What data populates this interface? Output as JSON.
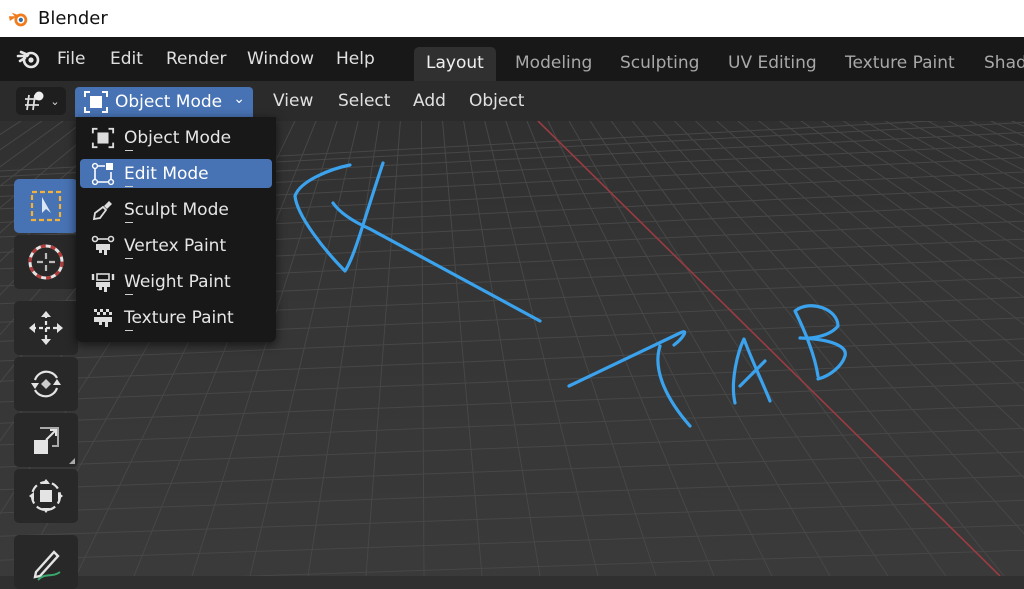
{
  "window": {
    "title": "Blender"
  },
  "menubar": {
    "items": [
      "File",
      "Edit",
      "Render",
      "Window",
      "Help"
    ],
    "workspace_tabs": [
      {
        "label": "Layout",
        "active": true
      },
      {
        "label": "Modeling",
        "active": false
      },
      {
        "label": "Sculpting",
        "active": false
      },
      {
        "label": "UV Editing",
        "active": false
      },
      {
        "label": "Texture Paint",
        "active": false
      },
      {
        "label": "Shad",
        "active": false
      }
    ]
  },
  "header": {
    "editor_type_icon": "3d-viewport-icon",
    "mode_select": {
      "label": "Object Mode",
      "icon": "object-mode-icon"
    },
    "menus": [
      "View",
      "Select",
      "Add",
      "Object"
    ]
  },
  "mode_dropdown": {
    "items": [
      {
        "label": "Object Mode",
        "icon": "object-mode-icon",
        "active": false
      },
      {
        "label": "Edit Mode",
        "icon": "edit-mode-icon",
        "active": true
      },
      {
        "label": "Sculpt Mode",
        "icon": "sculpt-mode-icon",
        "active": false
      },
      {
        "label": "Vertex Paint",
        "icon": "vertex-paint-icon",
        "active": false
      },
      {
        "label": "Weight Paint",
        "icon": "weight-paint-icon",
        "active": false
      },
      {
        "label": "Texture Paint",
        "icon": "texture-paint-icon",
        "active": false
      }
    ]
  },
  "toolbar": {
    "tools": [
      {
        "name": "select-box",
        "icon": "select-box-icon",
        "active": true
      },
      {
        "name": "cursor",
        "icon": "cursor-icon",
        "active": false
      },
      {
        "name": "move",
        "icon": "move-icon",
        "active": false
      },
      {
        "name": "rotate",
        "icon": "rotate-icon",
        "active": false
      },
      {
        "name": "scale",
        "icon": "scale-icon",
        "active": false
      },
      {
        "name": "transform",
        "icon": "transform-icon",
        "active": false
      },
      {
        "name": "annotate",
        "icon": "annotate-icon",
        "active": false
      }
    ]
  },
  "annotation": {
    "text": "TAB",
    "color": "#3ba3ee"
  },
  "colors": {
    "accent": "#4772b3",
    "x_axis": "#9b3b42",
    "annotation": "#3ba3ee"
  }
}
